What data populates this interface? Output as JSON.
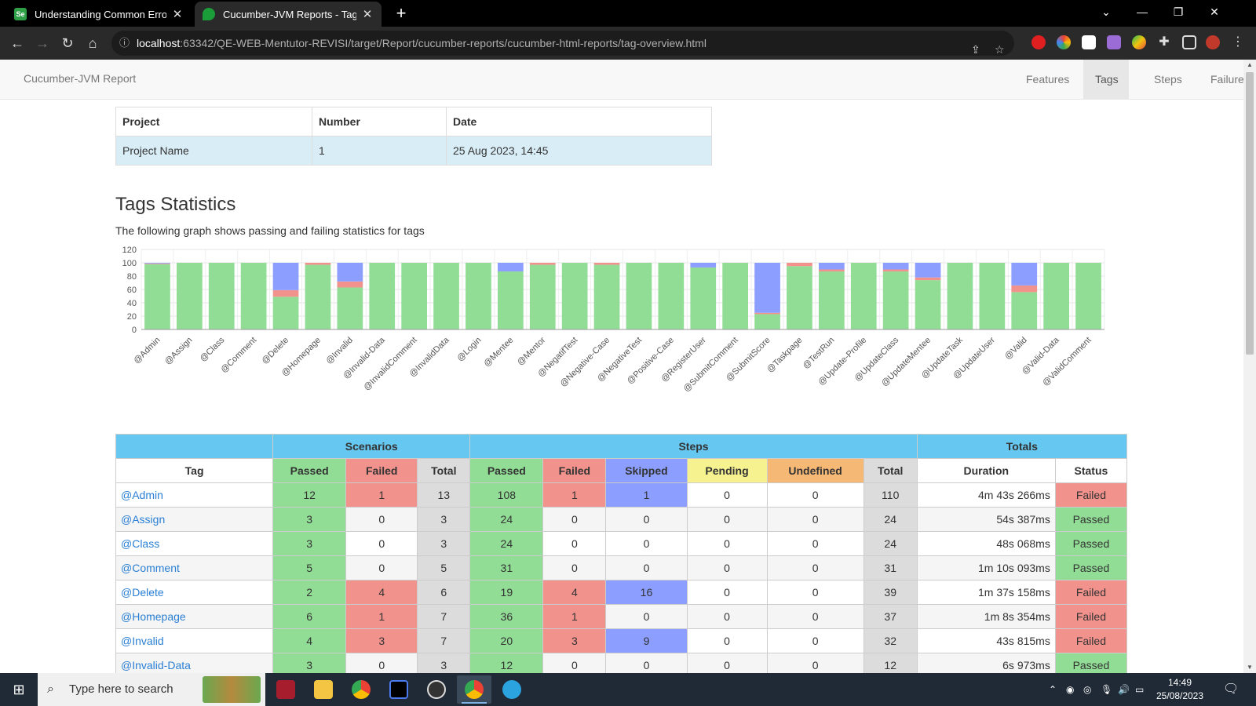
{
  "browser": {
    "tabs": [
      {
        "title": "Understanding Common Errors |",
        "favicon": "selenium-icon"
      },
      {
        "title": "Cucumber-JVM Reports - Tags O",
        "favicon": "cucumber-icon"
      }
    ],
    "url_host": "localhost",
    "url_rest": ":63342/QE-WEB-Mentutor-REVISI/target/Report/cucumber-reports/cucumber-html-reports/tag-overview.html"
  },
  "navbar": {
    "brand": "Cucumber-JVM Report",
    "links": [
      "Features",
      "Tags",
      "Steps",
      "Failures"
    ],
    "active": "Tags"
  },
  "project": {
    "headers": [
      "Project",
      "Number",
      "Date"
    ],
    "values": [
      "Project Name",
      "1",
      "25 Aug 2023, 14:45"
    ]
  },
  "section": {
    "title": "Tags Statistics",
    "lead": "The following graph shows passing and failing statistics for tags"
  },
  "chart_data": {
    "type": "bar",
    "stacked": true,
    "categories": [
      "@Admin",
      "@Assign",
      "@Class",
      "@Comment",
      "@Delete",
      "@Homepage",
      "@Invalid",
      "@Invalid-Data",
      "@InvalidComment",
      "@InvalidData",
      "@Login",
      "@Mentee",
      "@Mentor",
      "@NegatifTest",
      "@Negative-Case",
      "@NegativeTest",
      "@Positive-Case",
      "@RegisterUser",
      "@SubmitComment",
      "@SubmitScore",
      "@Taskpage",
      "@TestRun",
      "@Update-Profile",
      "@UpdateClass",
      "@UpdateMentee",
      "@UpdateTask",
      "@UpdateUser",
      "@Valid",
      "@Valid-Data",
      "@ValidComment"
    ],
    "series": [
      {
        "name": "Passed",
        "color": "#92dd96",
        "values": [
          98,
          100,
          100,
          100,
          49,
          97,
          63,
          100,
          100,
          100,
          100,
          87,
          97,
          100,
          97,
          100,
          100,
          93,
          100,
          23,
          95,
          87,
          100,
          87,
          74,
          100,
          100,
          56,
          100,
          100
        ]
      },
      {
        "name": "Failed",
        "color": "#f2928c",
        "values": [
          1,
          0,
          0,
          0,
          10,
          3,
          9,
          0,
          0,
          0,
          0,
          0,
          3,
          0,
          3,
          0,
          0,
          0,
          0,
          2,
          5,
          3,
          0,
          3,
          4,
          0,
          0,
          10,
          0,
          0
        ]
      },
      {
        "name": "Skipped",
        "color": "#8c9eff",
        "values": [
          1,
          0,
          0,
          0,
          41,
          0,
          28,
          0,
          0,
          0,
          0,
          13,
          0,
          0,
          0,
          0,
          0,
          7,
          0,
          75,
          0,
          10,
          0,
          10,
          22,
          0,
          0,
          34,
          0,
          0
        ]
      }
    ],
    "ylim": [
      0,
      120
    ],
    "yticks": [
      0,
      20,
      40,
      60,
      80,
      100,
      120
    ],
    "grid": true
  },
  "stats": {
    "group_headers": [
      "Scenarios",
      "Steps",
      "Totals"
    ],
    "columns": [
      "Tag",
      "Passed",
      "Failed",
      "Total",
      "Passed",
      "Failed",
      "Skipped",
      "Pending",
      "Undefined",
      "Total",
      "Duration",
      "Status"
    ],
    "rows": [
      {
        "tag": "@Admin",
        "sc_passed": "12",
        "sc_failed": "1",
        "sc_total": "13",
        "st_passed": "108",
        "st_failed": "1",
        "st_skipped": "1",
        "st_pending": "0",
        "st_undefined": "0",
        "st_total": "110",
        "duration": "4m 43s 266ms",
        "status": "Failed"
      },
      {
        "tag": "@Assign",
        "sc_passed": "3",
        "sc_failed": "0",
        "sc_total": "3",
        "st_passed": "24",
        "st_failed": "0",
        "st_skipped": "0",
        "st_pending": "0",
        "st_undefined": "0",
        "st_total": "24",
        "duration": "54s 387ms",
        "status": "Passed"
      },
      {
        "tag": "@Class",
        "sc_passed": "3",
        "sc_failed": "0",
        "sc_total": "3",
        "st_passed": "24",
        "st_failed": "0",
        "st_skipped": "0",
        "st_pending": "0",
        "st_undefined": "0",
        "st_total": "24",
        "duration": "48s 068ms",
        "status": "Passed"
      },
      {
        "tag": "@Comment",
        "sc_passed": "5",
        "sc_failed": "0",
        "sc_total": "5",
        "st_passed": "31",
        "st_failed": "0",
        "st_skipped": "0",
        "st_pending": "0",
        "st_undefined": "0",
        "st_total": "31",
        "duration": "1m 10s 093ms",
        "status": "Passed"
      },
      {
        "tag": "@Delete",
        "sc_passed": "2",
        "sc_failed": "4",
        "sc_total": "6",
        "st_passed": "19",
        "st_failed": "4",
        "st_skipped": "16",
        "st_pending": "0",
        "st_undefined": "0",
        "st_total": "39",
        "duration": "1m 37s 158ms",
        "status": "Failed"
      },
      {
        "tag": "@Homepage",
        "sc_passed": "6",
        "sc_failed": "1",
        "sc_total": "7",
        "st_passed": "36",
        "st_failed": "1",
        "st_skipped": "0",
        "st_pending": "0",
        "st_undefined": "0",
        "st_total": "37",
        "duration": "1m 8s 354ms",
        "status": "Failed"
      },
      {
        "tag": "@Invalid",
        "sc_passed": "4",
        "sc_failed": "3",
        "sc_total": "7",
        "st_passed": "20",
        "st_failed": "3",
        "st_skipped": "9",
        "st_pending": "0",
        "st_undefined": "0",
        "st_total": "32",
        "duration": "43s 815ms",
        "status": "Failed"
      },
      {
        "tag": "@Invalid-Data",
        "sc_passed": "3",
        "sc_failed": "0",
        "sc_total": "3",
        "st_passed": "12",
        "st_failed": "0",
        "st_skipped": "0",
        "st_pending": "0",
        "st_undefined": "0",
        "st_total": "12",
        "duration": "6s 973ms",
        "status": "Passed"
      }
    ]
  },
  "taskbar": {
    "search_placeholder": "Type here to search",
    "time": "14:49",
    "date": "25/08/2023"
  }
}
